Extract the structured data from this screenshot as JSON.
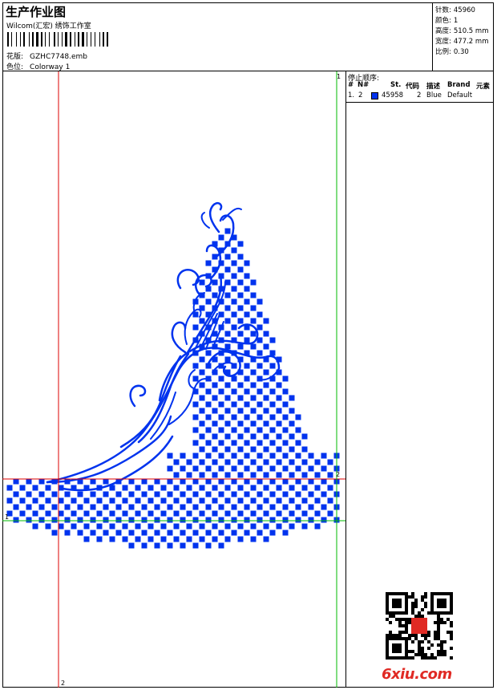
{
  "header": {
    "title": "生产作业图",
    "subtitle": "Wilcom(汇宏) 绣饰工作室",
    "design_label": "花版:",
    "design_value": "GZHC7748.emb",
    "colorway_label": "色位:",
    "colorway_value": "Colorway 1"
  },
  "stats": [
    {
      "label": "针数:",
      "value": "45960"
    },
    {
      "label": "颜色:",
      "value": "1"
    },
    {
      "label": "高度:",
      "value": "510.5 mm"
    },
    {
      "label": "宽度:",
      "value": "477.2 mm"
    },
    {
      "label": "比例:",
      "value": "0.30"
    }
  ],
  "stop_panel": {
    "title": "停止顺序:",
    "columns": {
      "idx": "#",
      "n": "N#",
      "st": "St.",
      "code": "代码",
      "desc": "描述",
      "brand": "Brand",
      "element": "元素"
    },
    "rows": [
      {
        "idx": "1.",
        "n": "2",
        "st": "45958",
        "code": "2",
        "desc": "Blue",
        "brand": "Default",
        "color": "#0033ee"
      }
    ]
  },
  "guides": {
    "top_right_marker": "1",
    "red_h_marker": "2",
    "red_v_marker": "2",
    "green_h_marker": "1"
  },
  "colors": {
    "thread": "#0033ee",
    "guide_red": "#dd0000",
    "guide_green": "#00bb00"
  },
  "watermark": {
    "site": "6xiu.com",
    "qr_icon": "qr-code-icon"
  }
}
